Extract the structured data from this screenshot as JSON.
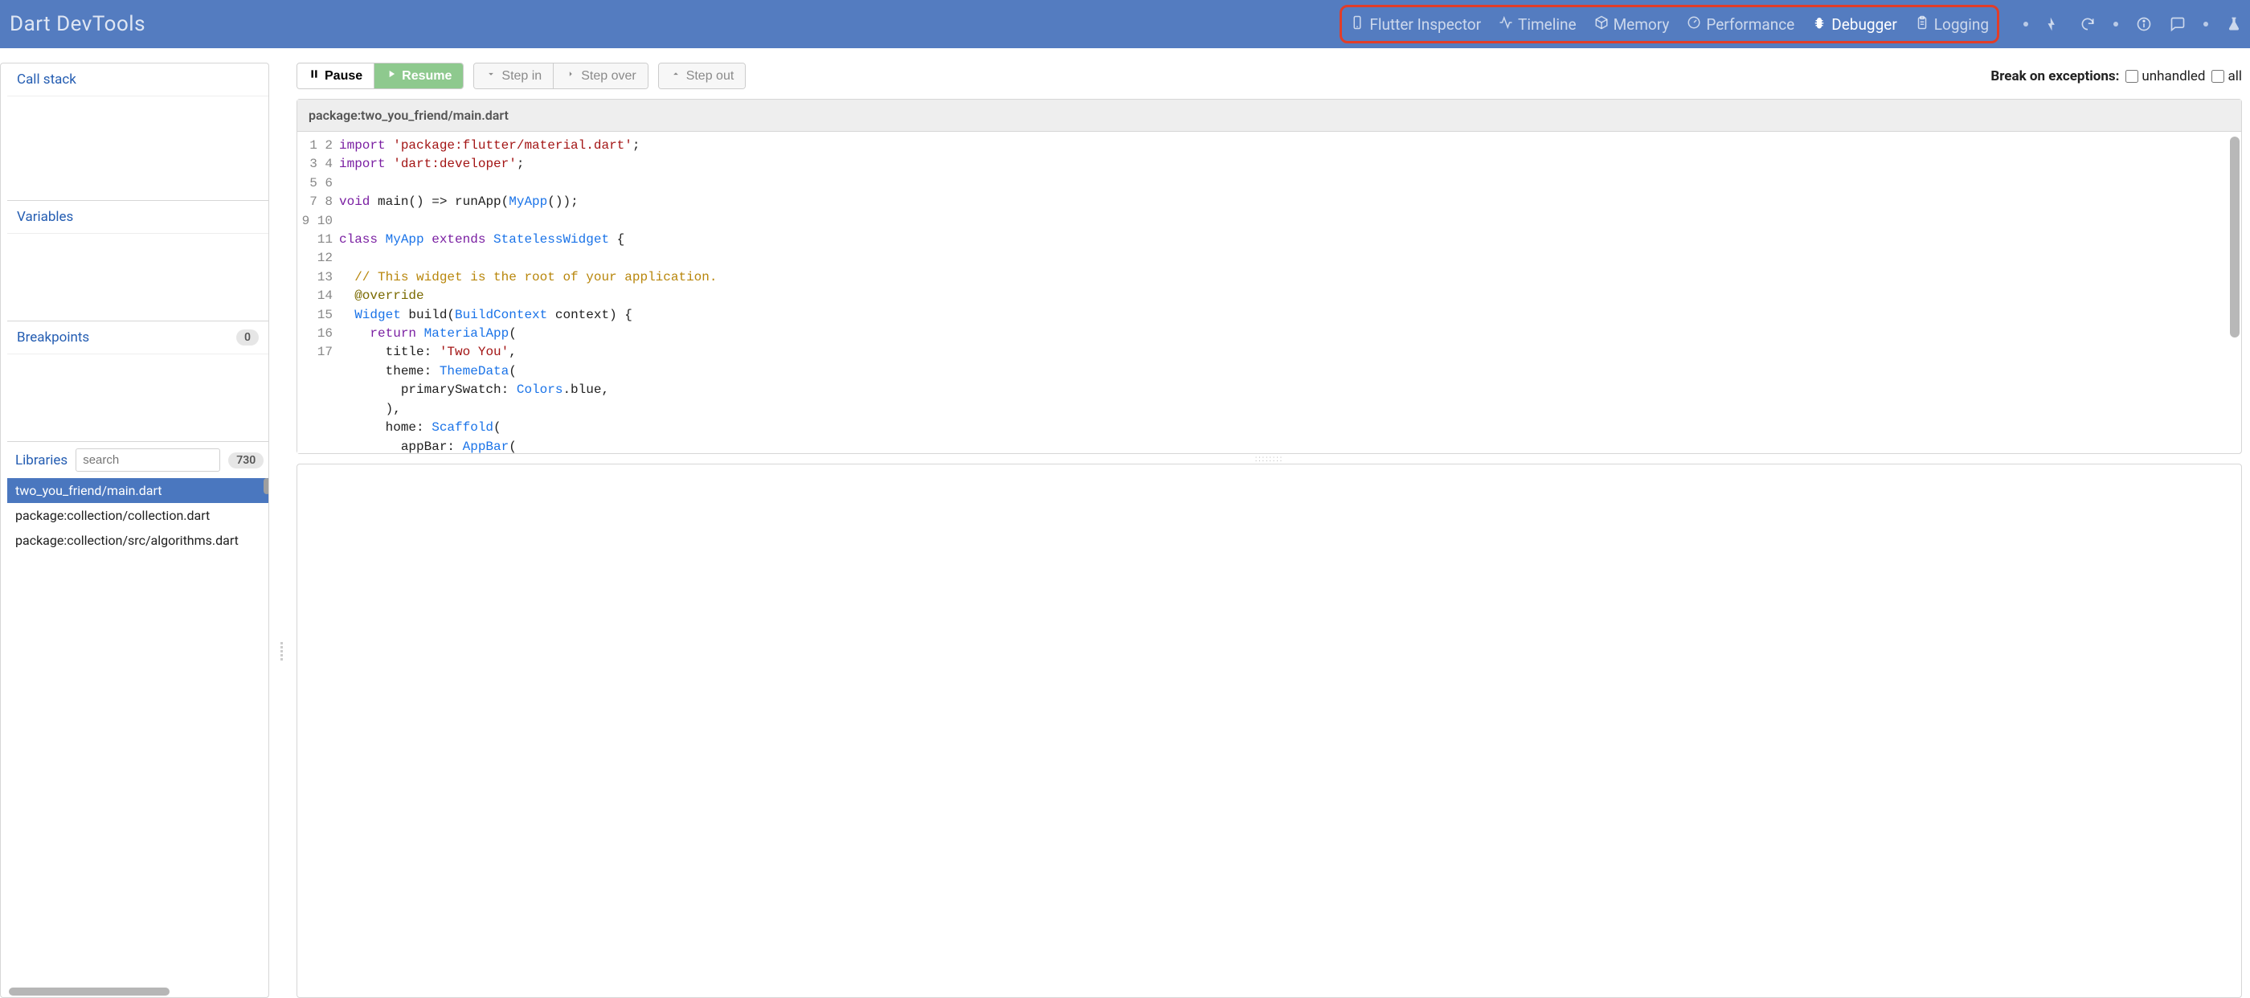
{
  "header": {
    "title": "Dart DevTools",
    "tabs": [
      {
        "label": "Flutter Inspector",
        "icon": "phone-icon",
        "active": false
      },
      {
        "label": "Timeline",
        "icon": "waveform-icon",
        "active": false
      },
      {
        "label": "Memory",
        "icon": "package-icon",
        "active": false
      },
      {
        "label": "Performance",
        "icon": "gauge-icon",
        "active": false
      },
      {
        "label": "Debugger",
        "icon": "bug-icon",
        "active": true
      },
      {
        "label": "Logging",
        "icon": "clipboard-icon",
        "active": false
      }
    ]
  },
  "toolbar": {
    "pause": "Pause",
    "resume": "Resume",
    "step_in": "Step in",
    "step_over": "Step over",
    "step_out": "Step out",
    "break_on_label": "Break on exceptions:",
    "unhandled_label": "unhandled",
    "all_label": "all",
    "unhandled_checked": false,
    "all_checked": false
  },
  "source": {
    "path": "package:two_you_friend/main.dart",
    "lines": [
      {
        "n": 1,
        "tokens": [
          {
            "t": "import ",
            "c": "kw"
          },
          {
            "t": "'package:flutter/material.dart'",
            "c": "str"
          },
          {
            "t": ";",
            "c": ""
          }
        ]
      },
      {
        "n": 2,
        "tokens": [
          {
            "t": "import ",
            "c": "kw"
          },
          {
            "t": "'dart:developer'",
            "c": "str"
          },
          {
            "t": ";",
            "c": ""
          }
        ]
      },
      {
        "n": 3,
        "tokens": [
          {
            "t": "",
            "c": ""
          }
        ]
      },
      {
        "n": 4,
        "tokens": [
          {
            "t": "void ",
            "c": "kw"
          },
          {
            "t": "main() => runApp(",
            "c": ""
          },
          {
            "t": "MyApp",
            "c": "type"
          },
          {
            "t": "());",
            "c": ""
          }
        ]
      },
      {
        "n": 5,
        "tokens": [
          {
            "t": "",
            "c": ""
          }
        ]
      },
      {
        "n": 6,
        "tokens": [
          {
            "t": "class ",
            "c": "kw"
          },
          {
            "t": "MyApp ",
            "c": "type"
          },
          {
            "t": "extends ",
            "c": "kw"
          },
          {
            "t": "StatelessWidget ",
            "c": "type"
          },
          {
            "t": "{",
            "c": ""
          }
        ]
      },
      {
        "n": 7,
        "tokens": [
          {
            "t": "",
            "c": ""
          }
        ]
      },
      {
        "n": 8,
        "tokens": [
          {
            "t": "  // This widget is the root of your application.",
            "c": "com"
          }
        ]
      },
      {
        "n": 9,
        "tokens": [
          {
            "t": "  ",
            "c": ""
          },
          {
            "t": "@override",
            "c": "anno"
          }
        ]
      },
      {
        "n": 10,
        "tokens": [
          {
            "t": "  ",
            "c": ""
          },
          {
            "t": "Widget ",
            "c": "type"
          },
          {
            "t": "build(",
            "c": ""
          },
          {
            "t": "BuildContext ",
            "c": "type"
          },
          {
            "t": "context) {",
            "c": ""
          }
        ]
      },
      {
        "n": 11,
        "tokens": [
          {
            "t": "    ",
            "c": ""
          },
          {
            "t": "return ",
            "c": "kw"
          },
          {
            "t": "MaterialApp",
            "c": "type"
          },
          {
            "t": "(",
            "c": ""
          }
        ]
      },
      {
        "n": 12,
        "tokens": [
          {
            "t": "      title: ",
            "c": ""
          },
          {
            "t": "'Two You'",
            "c": "str"
          },
          {
            "t": ",",
            "c": ""
          }
        ]
      },
      {
        "n": 13,
        "tokens": [
          {
            "t": "      theme: ",
            "c": ""
          },
          {
            "t": "ThemeData",
            "c": "type"
          },
          {
            "t": "(",
            "c": ""
          }
        ]
      },
      {
        "n": 14,
        "tokens": [
          {
            "t": "        primarySwatch: ",
            "c": ""
          },
          {
            "t": "Colors",
            "c": "type"
          },
          {
            "t": ".blue,",
            "c": ""
          }
        ]
      },
      {
        "n": 15,
        "tokens": [
          {
            "t": "      ),",
            "c": ""
          }
        ]
      },
      {
        "n": 16,
        "tokens": [
          {
            "t": "      home: ",
            "c": ""
          },
          {
            "t": "Scaffold",
            "c": "type"
          },
          {
            "t": "(",
            "c": ""
          }
        ]
      },
      {
        "n": 17,
        "tokens": [
          {
            "t": "        appBar: ",
            "c": ""
          },
          {
            "t": "AppBar",
            "c": "type"
          },
          {
            "t": "(",
            "c": ""
          }
        ]
      }
    ]
  },
  "panels": {
    "call_stack": {
      "title": "Call stack"
    },
    "variables": {
      "title": "Variables"
    },
    "breakpoints": {
      "title": "Breakpoints",
      "count": "0"
    },
    "libraries": {
      "title": "Libraries",
      "search_placeholder": "search",
      "count": "730",
      "items": [
        {
          "label": "two_you_friend/main.dart",
          "selected": true
        },
        {
          "label": "package:collection/collection.dart",
          "selected": false
        },
        {
          "label": "package:collection/src/algorithms.dart",
          "selected": false
        }
      ]
    }
  }
}
